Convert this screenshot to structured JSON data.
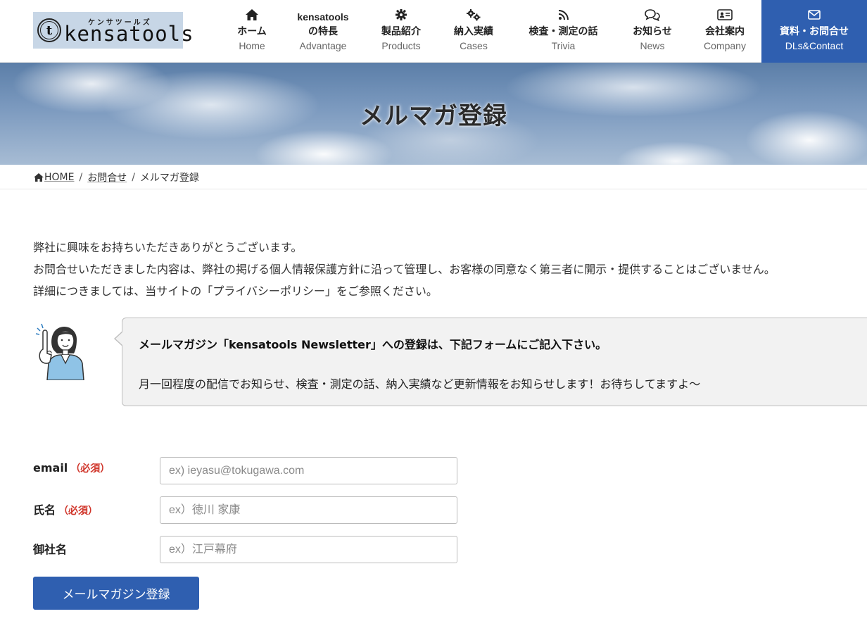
{
  "brand": {
    "logo_sub": "ケンサツールズ",
    "logo_text": "kensatools",
    "logo_mark": "t"
  },
  "nav": {
    "items": [
      {
        "ja": "ホーム",
        "en": "Home",
        "icon": "home-icon"
      },
      {
        "ja_line1": "kensatools",
        "ja": "の特長",
        "en": "Advantage"
      },
      {
        "ja": "製品紹介",
        "en": "Products",
        "icon": "gear-icon"
      },
      {
        "ja": "納入実績",
        "en": "Cases",
        "icon": "gears-icon"
      },
      {
        "ja": "検査・測定の話",
        "en": "Trivia",
        "icon": "rss-icon"
      },
      {
        "ja": "お知らせ",
        "en": "News",
        "icon": "chat-icon"
      },
      {
        "ja": "会社案内",
        "en": "Company",
        "icon": "id-card-icon"
      },
      {
        "ja": "資料・お問合せ",
        "en": "DLs&Contact",
        "icon": "envelope-icon"
      }
    ],
    "cta_color": "#2f5fb0"
  },
  "hero": {
    "title": "メルマガ登録"
  },
  "breadcrumb": {
    "home": "HOME",
    "sep": "/",
    "parent": "お問合せ",
    "current": "メルマガ登録"
  },
  "intro": {
    "line1": "弊社に興味をお持ちいただきありがとうございます。",
    "line2": "お問合せいただきました内容は、弊社の掲げる個人情報保護方針に沿って管理し、お客様の同意なく第三者に開示・提供することはございません。",
    "line3": "詳細につきましては、当サイトの「プライバシーポリシー」をご参照ください。"
  },
  "speech": {
    "strong": "メールマガジン「kensatools Newsletter」への登録は、下記フォームにご記入下さい。",
    "text": "月一回程度の配信でお知らせ、検査・測定の話、納入実績など更新情報をお知らせします！お待ちしてますよ〜"
  },
  "form": {
    "required_mark": "（必須）",
    "email": {
      "label": "email",
      "placeholder": "ex) ieyasu@tokugawa.com",
      "value": ""
    },
    "name": {
      "label": "氏名",
      "placeholder": "ex）徳川 家康",
      "value": ""
    },
    "company": {
      "label": "御社名",
      "placeholder": "ex）江戸幕府",
      "value": ""
    },
    "submit_label": "メールマガジン登録"
  },
  "colors": {
    "accent": "#2f5fb0",
    "required": "#d0352a"
  }
}
